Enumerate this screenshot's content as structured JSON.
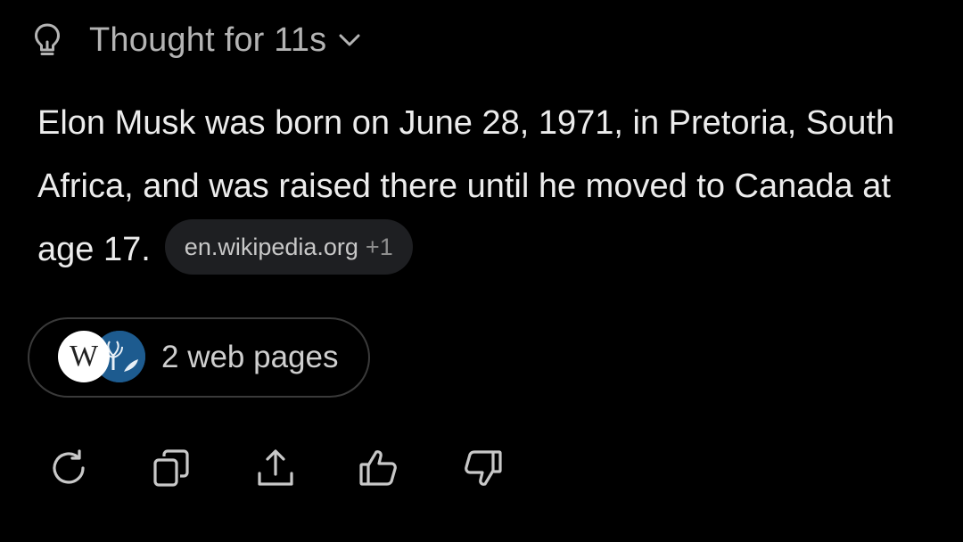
{
  "thought": {
    "label": "Thought for 11s",
    "icon": "lightbulb-icon",
    "toggle_icon": "chevron-down-icon"
  },
  "answer": {
    "text": "Elon Musk was born on June 28, 1971, in Pretoria, South Africa, and was raised there until he moved to Canada at age 17."
  },
  "source_chip": {
    "domain": "en.wikipedia.org",
    "extra": "+1"
  },
  "web_pages": {
    "label": "2 web pages",
    "favicons": [
      "wikipedia-favicon",
      "britannica-favicon"
    ]
  },
  "actions": [
    {
      "name": "regenerate-icon"
    },
    {
      "name": "copy-icon"
    },
    {
      "name": "share-icon"
    },
    {
      "name": "thumbs-up-icon"
    },
    {
      "name": "thumbs-down-icon"
    }
  ],
  "colors": {
    "background": "#000000",
    "text": "#ececec",
    "muted": "#b4b4b4",
    "chip_bg": "#1e1f22",
    "border": "#3a3a3a"
  }
}
